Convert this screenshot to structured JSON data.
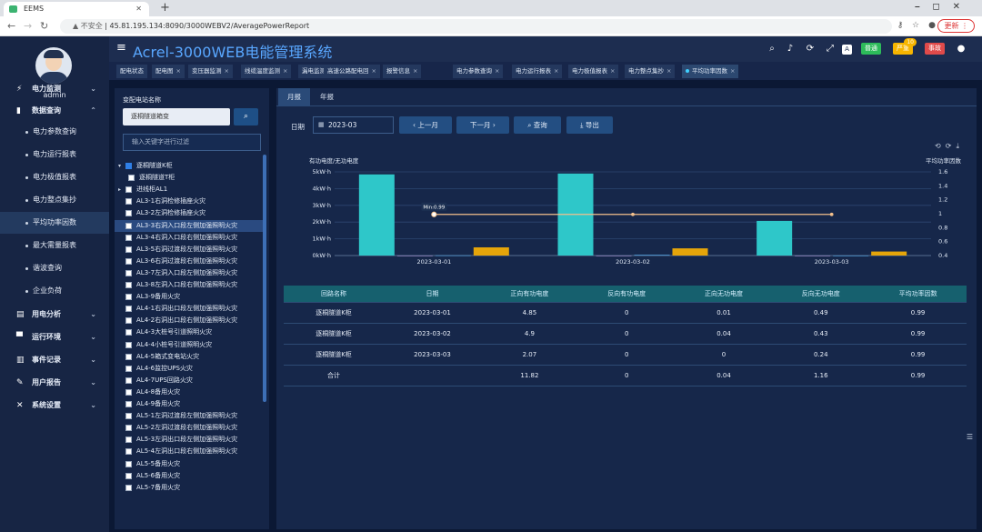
{
  "browser": {
    "tab_title": "EEMS",
    "url_warning": "不安全",
    "url": "45.81.195.134:8090/3000WEBV2/AveragePowerReport",
    "update_label": "更新"
  },
  "sidebar": {
    "username": "admin",
    "items": [
      {
        "label": "电力监测",
        "type": "group",
        "icon": "lightning-icon",
        "chev": "⌄"
      },
      {
        "label": "数据查询",
        "type": "group",
        "icon": "bar-chart-icon",
        "chev": "⌃"
      },
      {
        "label": "电力参数查询",
        "type": "sub"
      },
      {
        "label": "电力运行报表",
        "type": "sub"
      },
      {
        "label": "电力极值报表",
        "type": "sub"
      },
      {
        "label": "电力整点集抄",
        "type": "sub"
      },
      {
        "label": "平均功率因数",
        "type": "sub",
        "active": true
      },
      {
        "label": "最大需量报表",
        "type": "sub"
      },
      {
        "label": "谐波查询",
        "type": "sub"
      },
      {
        "label": "企业负荷",
        "type": "sub"
      },
      {
        "label": "用电分析",
        "type": "group",
        "icon": "analysis-icon",
        "chev": "⌄"
      },
      {
        "label": "运行环境",
        "type": "group",
        "icon": "environment-icon",
        "chev": "⌄"
      },
      {
        "label": "事件记录",
        "type": "group",
        "icon": "event-icon",
        "chev": "⌄"
      },
      {
        "label": "用户报告",
        "type": "group",
        "icon": "report-icon",
        "chev": "⌄"
      },
      {
        "label": "系统设置",
        "type": "group",
        "icon": "settings-icon",
        "chev": "⌄"
      }
    ]
  },
  "header": {
    "title": "Acrel-3000WEB电能管理系统",
    "badges": [
      {
        "label": "普通",
        "color": "#2dbb5a"
      },
      {
        "label": "严重",
        "color": "#f7b500",
        "count": "10"
      },
      {
        "label": "事故",
        "color": "#e04a4a"
      }
    ]
  },
  "page_tabs": [
    "配电状态",
    "配电图",
    "变压器监测",
    "线缆温度监测",
    "漏电监测",
    "高速公路配电回",
    "报警信息",
    "电力参数查询",
    "电力运行报表",
    "电力极值报表",
    "电力整点集抄",
    "平均功率因数"
  ],
  "left_panel": {
    "title": "变配电站名称",
    "selected_station": "逐桐隧道箱变",
    "filter_placeholder": "输入关键字进行过滤",
    "tree": [
      {
        "label": "逐桐隧道K柜",
        "level": 0,
        "checked": true,
        "expand": "down"
      },
      {
        "label": "逐桐隧道T柜",
        "level": 1
      },
      {
        "label": "进线柜AL1",
        "level": 0,
        "expand": "right"
      },
      {
        "label": "AL3-1右洞检修插座火灾",
        "level": 0
      },
      {
        "label": "AL3-2左洞检修插座火灾",
        "level": 0
      },
      {
        "label": "AL3-3右洞入口段左侧加强照明火灾",
        "level": 0,
        "highlight": true
      },
      {
        "label": "AL3-4右洞入口段右侧加强照明火灾",
        "level": 0
      },
      {
        "label": "AL3-5右洞过渡段左侧加强照明火灾",
        "level": 0
      },
      {
        "label": "AL3-6右洞过渡段右侧加强照明火灾",
        "level": 0
      },
      {
        "label": "AL3-7左洞入口段左侧加强照明火灾",
        "level": 0
      },
      {
        "label": "AL3-8左洞入口段右侧加强照明火灾",
        "level": 0
      },
      {
        "label": "AL3-9备用火灾",
        "level": 0
      },
      {
        "label": "AL4-1右洞出口段左侧加强照明火灾",
        "level": 0
      },
      {
        "label": "AL4-2右洞出口段右侧加强照明火灾",
        "level": 0
      },
      {
        "label": "AL4-3大桩号引道照明火灾",
        "level": 0
      },
      {
        "label": "AL4-4小桩号引道照明火灾",
        "level": 0
      },
      {
        "label": "AL4-5箱式变电站火灾",
        "level": 0
      },
      {
        "label": "AL4-6监控UPS火灾",
        "level": 0
      },
      {
        "label": "AL4-7UPS回路火灾",
        "level": 0
      },
      {
        "label": "AL4-8备用火灾",
        "level": 0
      },
      {
        "label": "AL4-9备用火灾",
        "level": 0
      },
      {
        "label": "AL5-1左洞过渡段左侧加强照明火灾",
        "level": 0
      },
      {
        "label": "AL5-2左洞过渡段右侧加强照明火灾",
        "level": 0
      },
      {
        "label": "AL5-3左洞出口段左侧加强照明火灾",
        "level": 0
      },
      {
        "label": "AL5-4左洞出口段右侧加强照明火灾",
        "level": 0
      },
      {
        "label": "AL5-5备用火灾",
        "level": 0
      },
      {
        "label": "AL5-6备用火灾",
        "level": 0
      },
      {
        "label": "AL5-7备用火灾",
        "level": 0
      }
    ]
  },
  "main": {
    "subtabs": [
      "月报",
      "年报"
    ],
    "date_label": "日期",
    "date_value": "2023-03",
    "prev_label": "‹ 上一月",
    "next_label": "下一月 ›",
    "query_label": "⌕ 查询",
    "export_label": "⤓ 导出"
  },
  "chart_data": {
    "type": "bar",
    "categories": [
      "2023-03-01",
      "2023-03-02",
      "2023-03-03"
    ],
    "left_axis_title": "有功电度/无功电度",
    "right_axis_title": "平均功率因数",
    "left_ticks": [
      "0kW·h",
      "1kW·h",
      "2kW·h",
      "3kW·h",
      "4kW·h",
      "5kW·h"
    ],
    "right_ticks": [
      "0.4",
      "0.6",
      "0.8",
      "1",
      "1.2",
      "1.4",
      "1.6"
    ],
    "ylim": [
      0,
      5
    ],
    "y2lim": [
      0.4,
      1.6
    ],
    "series": [
      {
        "name": "正向有功电度",
        "type": "bar",
        "color": "#2ec7c9",
        "values": [
          4.85,
          4.9,
          2.07
        ]
      },
      {
        "name": "反向有功电度",
        "type": "bar",
        "color": "#b6a2de",
        "values": [
          0,
          0,
          0
        ]
      },
      {
        "name": "正向无功电度",
        "type": "bar",
        "color": "#5ab1ef",
        "values": [
          0.01,
          0.04,
          0
        ]
      },
      {
        "name": "反向无功电度",
        "type": "bar",
        "color": "#e5a50a",
        "values": [
          0.49,
          0.43,
          0.24
        ]
      },
      {
        "name": "平均功率因数",
        "type": "line",
        "color": "#f3c08c",
        "values": [
          0.99,
          0.99,
          0.99
        ]
      }
    ],
    "annotation": "Min:0.99"
  },
  "table": {
    "headers": [
      "回路名称",
      "日期",
      "正向有功电度",
      "反向有功电度",
      "正向无功电度",
      "反向无功电度",
      "平均功率因数"
    ],
    "rows": [
      [
        "逐桐隧道K柜",
        "2023-03-01",
        "4.85",
        "0",
        "0.01",
        "0.49",
        "0.99"
      ],
      [
        "逐桐隧道K柜",
        "2023-03-02",
        "4.9",
        "0",
        "0.04",
        "0.43",
        "0.99"
      ],
      [
        "逐桐隧道K柜",
        "2023-03-03",
        "2.07",
        "0",
        "0",
        "0.24",
        "0.99"
      ],
      [
        "合计",
        "",
        "11.82",
        "0",
        "0.04",
        "1.16",
        "0.99"
      ]
    ]
  }
}
